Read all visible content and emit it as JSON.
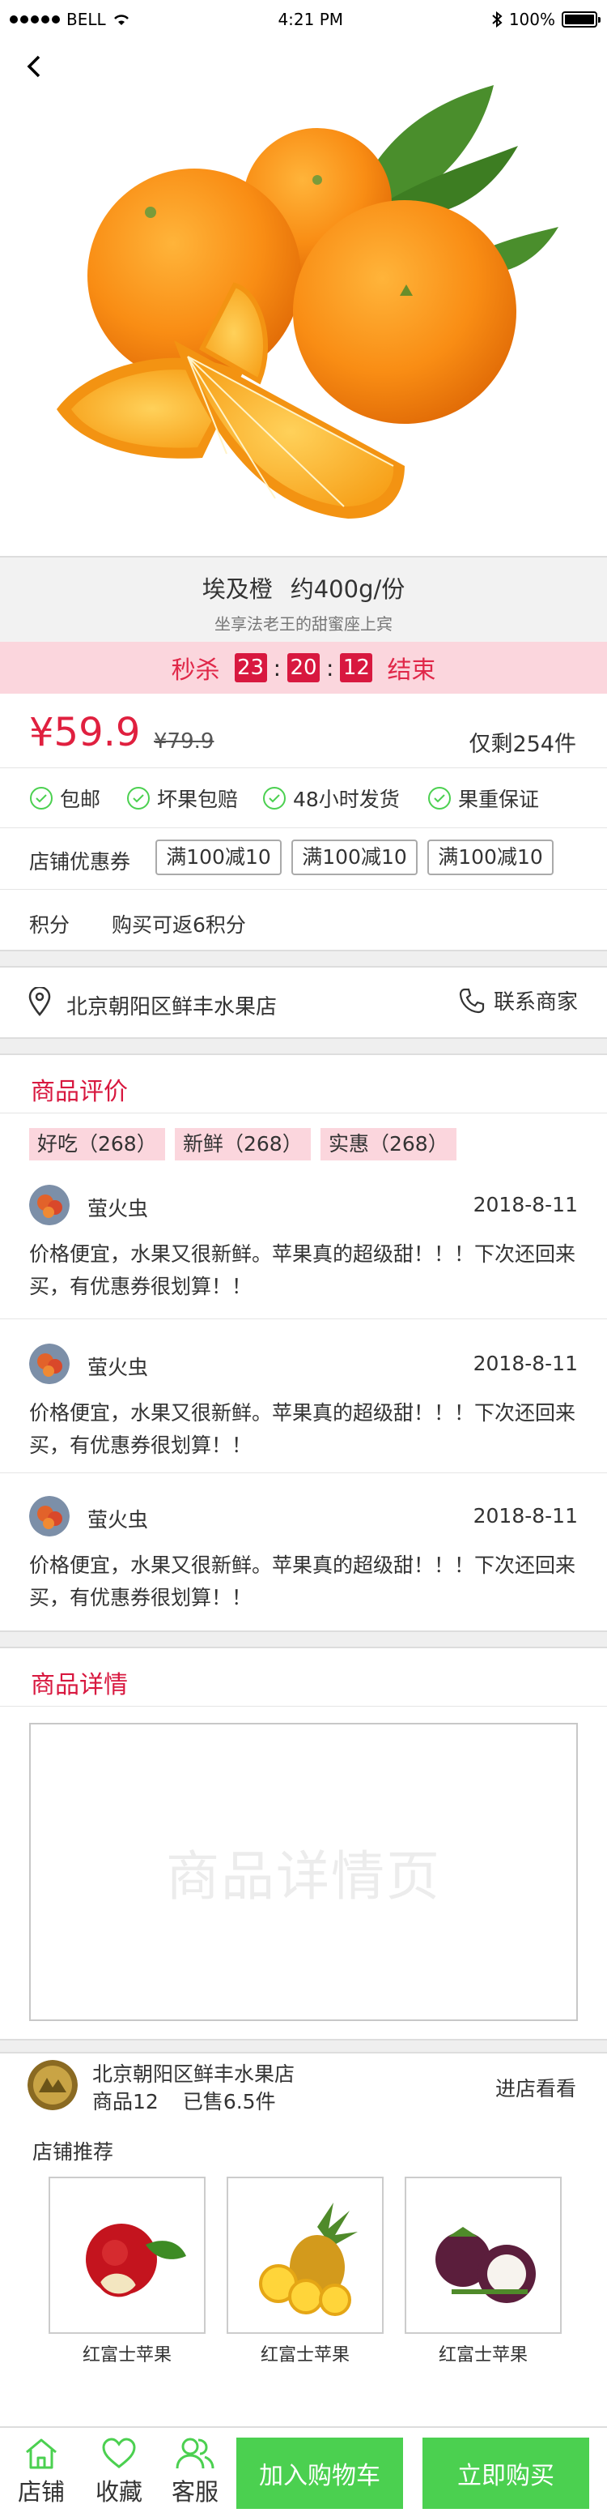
{
  "status_bar": {
    "carrier": "BELL",
    "time": "4:21 PM",
    "battery": "100%"
  },
  "product": {
    "name": "埃及橙",
    "spec": "约400g/份",
    "subtitle": "坐享法老王的甜蜜座上宾",
    "price": "¥59.9",
    "old_price": "¥79.9",
    "stock": "仅剩254件"
  },
  "flash_sale": {
    "label": "秒杀",
    "hh": "23",
    "mm": "20",
    "ss": "12",
    "end_label": "结束",
    "sep": ":"
  },
  "guarantees": [
    "包邮",
    "坏果包赔",
    "48小时发货",
    "果重保证"
  ],
  "coupons": {
    "label": "店铺优惠券",
    "items": [
      "满100减10",
      "满100减10",
      "满100减10"
    ]
  },
  "points": {
    "label": "积分",
    "value": "购买可返6积分"
  },
  "location": {
    "address": "北京朝阳区鲜丰水果店",
    "contact": "联系商家"
  },
  "reviews": {
    "title": "商品评价",
    "tags": [
      "好吃（268）",
      "新鲜（268）",
      "实惠（268）"
    ],
    "items": [
      {
        "user": "萤火虫",
        "date": "2018-8-11",
        "text": "价格便宜，水果又很新鲜。苹果真的超级甜！！！下次还回来买，有优惠券很划算！！"
      },
      {
        "user": "萤火虫",
        "date": "2018-8-11",
        "text": "价格便宜，水果又很新鲜。苹果真的超级甜！！！下次还回来买，有优惠券很划算！！"
      },
      {
        "user": "萤火虫",
        "date": "2018-8-11",
        "text": "价格便宜，水果又很新鲜。苹果真的超级甜！！！下次还回来买，有优惠券很划算！！"
      }
    ]
  },
  "details": {
    "title": "商品详情",
    "placeholder": "商品详情页"
  },
  "shop": {
    "name": "北京朝阳区鲜丰水果店",
    "goods": "商品12",
    "sold": "已售6.5件",
    "enter": "进店看看",
    "recommend_label": "店铺推荐",
    "recommend": [
      "红富士苹果",
      "红富士苹果",
      "红富士苹果"
    ]
  },
  "bottom_bar": {
    "store": "店铺",
    "favorite": "收藏",
    "service": "客服",
    "add_cart": "加入购物车",
    "buy_now": "立即购买"
  },
  "colors": {
    "accent": "#d8183f",
    "price": "#e0203f",
    "green": "#4bd050",
    "pink": "#fbd6dd"
  }
}
